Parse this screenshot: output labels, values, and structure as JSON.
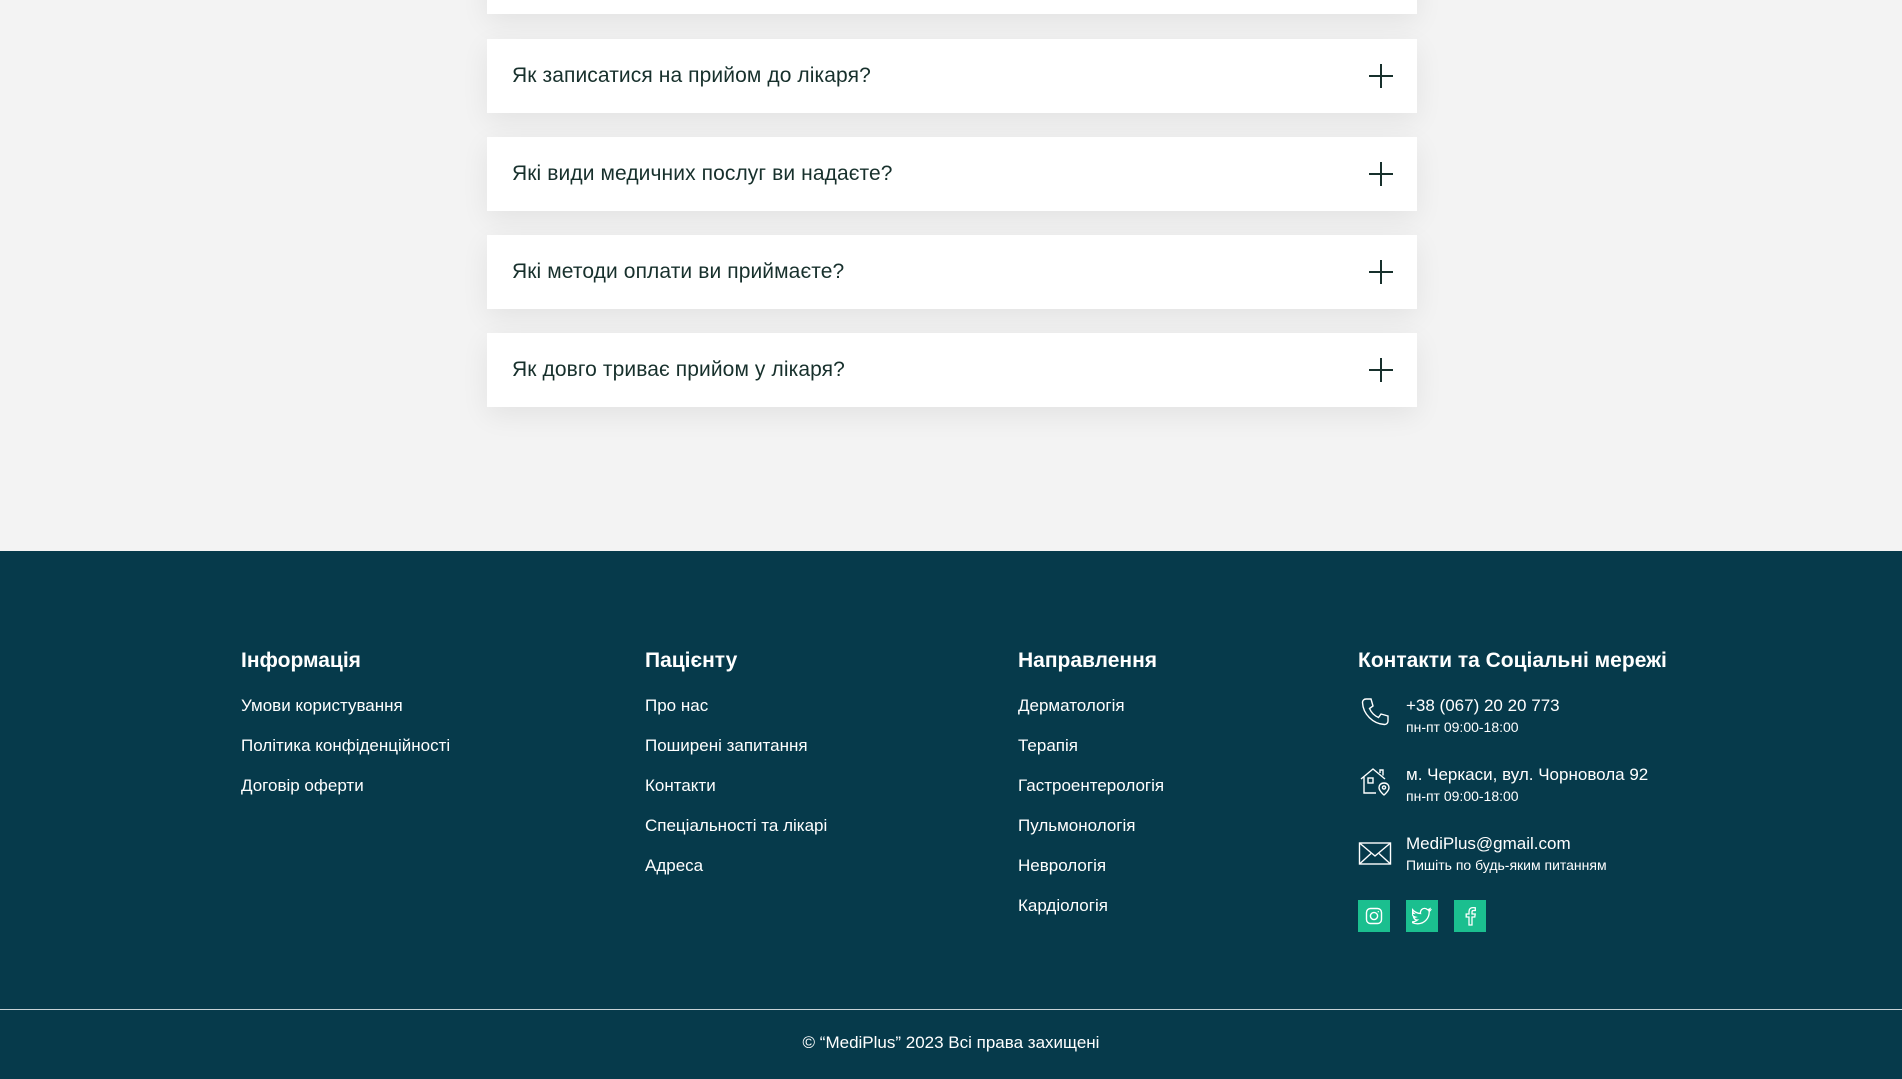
{
  "faq": {
    "items": [
      {
        "question": ""
      },
      {
        "question": "Як записатися на прийом до лікаря?"
      },
      {
        "question": "Які види медичних послуг ви надаєте?"
      },
      {
        "question": "Які методи оплати ви приймаєте?"
      },
      {
        "question": "Як довго триває прийом у лікаря?"
      }
    ]
  },
  "footer": {
    "info": {
      "title": "Інформація",
      "links": [
        "Умови користування",
        "Політика конфіденційності",
        "Договір оферти"
      ]
    },
    "patient": {
      "title": "Пацієнту",
      "links": [
        "Про нас",
        "Поширені запитання",
        "Контакти",
        "Спеціальності та лікарі",
        "Адреса"
      ]
    },
    "directions": {
      "title": "Направлення",
      "links": [
        "Дерматологія",
        "Терапія",
        "Гастроентерологія",
        "Пульмонологія",
        "Неврологія",
        "Кардіологія"
      ]
    },
    "contacts": {
      "title": "Контакти та Соціальні мережі",
      "phone": "+38 (067) 20 20 773",
      "phone_hours": "пн-пт 09:00-18:00",
      "address": "м. Черкаси, вул. Чорновола 92",
      "address_hours": "пн-пт 09:00-18:00",
      "email": "MediPlus@gmail.com",
      "email_note": "Пишіть по будь-яким питанням"
    },
    "copyright": "© “MediPlus” 2023 Всі права захищені"
  },
  "colors": {
    "footer_bg": "#063a4b",
    "accent": "#1bbf8f",
    "page_bg": "#f3f3f3"
  }
}
